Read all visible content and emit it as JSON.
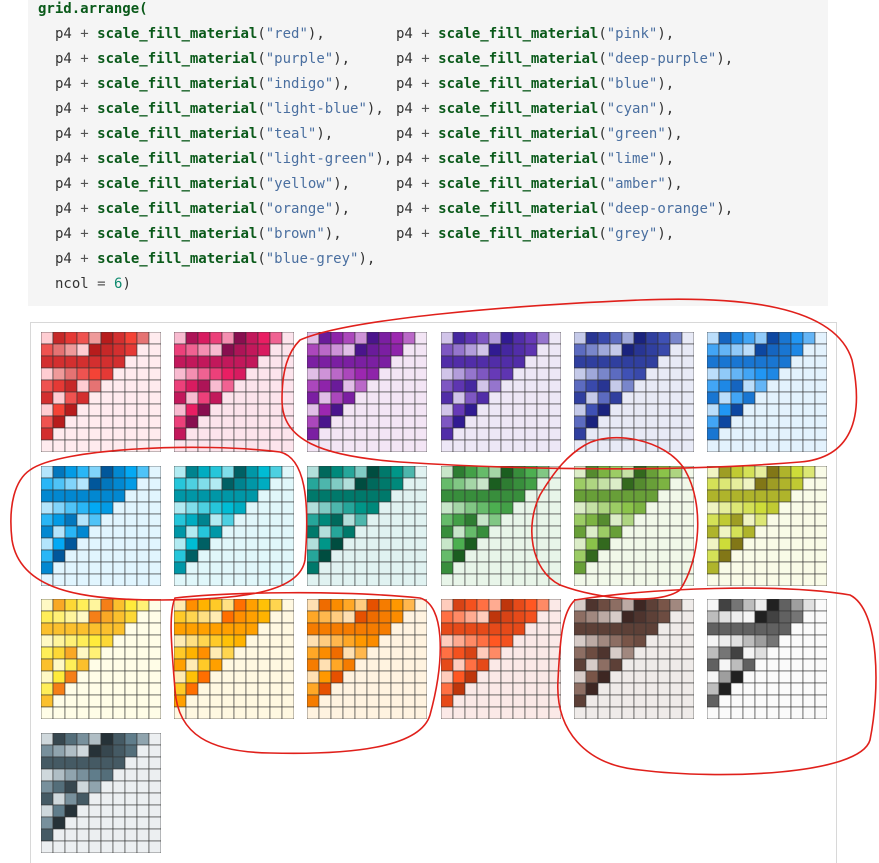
{
  "code": {
    "open": "grid.arrange(",
    "plot_var": "p4",
    "plus": "+",
    "function": "scale_fill_material",
    "palettes": [
      "red",
      "pink",
      "purple",
      "deep-purple",
      "indigo",
      "blue",
      "light-blue",
      "cyan",
      "teal",
      "green",
      "light-green",
      "lime",
      "yellow",
      "amber",
      "orange",
      "deep-orange",
      "brown",
      "grey",
      "blue-grey"
    ],
    "ncol_label": "ncol",
    "ncol_equals": "=",
    "ncol_value": "6",
    "close": ")"
  },
  "chart_data": {
    "type": "heatmap",
    "layout": {
      "ncol": 6,
      "count": 19
    },
    "plots": [
      {
        "palette": "red",
        "colors": [
          "#ffebee",
          "#ffcdd2",
          "#ef9a9a",
          "#e57373",
          "#ef5350",
          "#f44336",
          "#e53935",
          "#d32f2f",
          "#c62828",
          "#b71c1c"
        ]
      },
      {
        "palette": "pink",
        "colors": [
          "#fce4ec",
          "#f8bbd0",
          "#f48fb1",
          "#f06292",
          "#ec407a",
          "#e91e63",
          "#d81b60",
          "#c2185b",
          "#ad1457",
          "#880e4f"
        ]
      },
      {
        "palette": "purple",
        "colors": [
          "#f3e5f5",
          "#e1bee7",
          "#ce93d8",
          "#ba68c8",
          "#ab47bc",
          "#9c27b0",
          "#8e24aa",
          "#7b1fa2",
          "#6a1b9a",
          "#4a148c"
        ]
      },
      {
        "palette": "deep-purple",
        "colors": [
          "#ede7f6",
          "#d1c4e9",
          "#b39ddb",
          "#9575cd",
          "#7e57c2",
          "#673ab7",
          "#5e35b1",
          "#512da8",
          "#4527a0",
          "#311b92"
        ]
      },
      {
        "palette": "indigo",
        "colors": [
          "#e8eaf6",
          "#c5cae9",
          "#9fa8da",
          "#7986cb",
          "#5c6bc0",
          "#3f51b5",
          "#3949ab",
          "#303f9f",
          "#283593",
          "#1a237e"
        ]
      },
      {
        "palette": "blue",
        "colors": [
          "#e3f2fd",
          "#bbdefb",
          "#90caf9",
          "#64b5f6",
          "#42a5f5",
          "#2196f3",
          "#1e88e5",
          "#1976d2",
          "#1565c0",
          "#0d47a1"
        ]
      },
      {
        "palette": "light-blue",
        "colors": [
          "#e1f5fe",
          "#b3e5fc",
          "#81d4fa",
          "#4fc3f7",
          "#29b6f6",
          "#03a9f4",
          "#039be5",
          "#0288d1",
          "#0277bd",
          "#01579b"
        ]
      },
      {
        "palette": "cyan",
        "colors": [
          "#e0f7fa",
          "#b2ebf2",
          "#80deea",
          "#4dd0e1",
          "#26c6da",
          "#00bcd4",
          "#00acc1",
          "#0097a7",
          "#00838f",
          "#006064"
        ]
      },
      {
        "palette": "teal",
        "colors": [
          "#e0f2f1",
          "#b2dfdb",
          "#80cbc4",
          "#4db6ac",
          "#26a69a",
          "#009688",
          "#00897b",
          "#00796b",
          "#00695c",
          "#004d40"
        ]
      },
      {
        "palette": "green",
        "colors": [
          "#e8f5e9",
          "#c8e6c9",
          "#a5d6a7",
          "#81c784",
          "#66bb6a",
          "#4caf50",
          "#43a047",
          "#388e3c",
          "#2e7d32",
          "#1b5e20"
        ]
      },
      {
        "palette": "light-green",
        "colors": [
          "#f1f8e9",
          "#dcedc8",
          "#c5e1a5",
          "#aed581",
          "#9ccc65",
          "#8bc34a",
          "#7cb342",
          "#689f38",
          "#558b2f",
          "#33691e"
        ]
      },
      {
        "palette": "lime",
        "colors": [
          "#f9fbe7",
          "#f0f4c3",
          "#e6ee9c",
          "#dce775",
          "#d4e157",
          "#cddc39",
          "#c0ca33",
          "#afb42b",
          "#9e9d24",
          "#827717"
        ]
      },
      {
        "palette": "yellow",
        "colors": [
          "#fffde7",
          "#fff9c4",
          "#fff59d",
          "#fff176",
          "#ffee58",
          "#ffeb3b",
          "#fdd835",
          "#fbc02d",
          "#f9a825",
          "#f57f17"
        ]
      },
      {
        "palette": "amber",
        "colors": [
          "#fff8e1",
          "#ffecb3",
          "#ffe082",
          "#ffd54f",
          "#ffca28",
          "#ffc107",
          "#ffb300",
          "#ffa000",
          "#ff8f00",
          "#ff6f00"
        ]
      },
      {
        "palette": "orange",
        "colors": [
          "#fff3e0",
          "#ffe0b2",
          "#ffcc80",
          "#ffb74d",
          "#ffa726",
          "#ff9800",
          "#fb8c00",
          "#f57c00",
          "#ef6c00",
          "#e65100"
        ]
      },
      {
        "palette": "deep-orange",
        "colors": [
          "#fbe9e7",
          "#ffccbc",
          "#ffab91",
          "#ff8a65",
          "#ff7043",
          "#ff5722",
          "#f4511e",
          "#e64a19",
          "#d84315",
          "#bf360c"
        ]
      },
      {
        "palette": "brown",
        "colors": [
          "#efebe9",
          "#d7ccc8",
          "#bcaaa4",
          "#a1887f",
          "#8d6e63",
          "#795548",
          "#6d4c41",
          "#5d4037",
          "#4e342e",
          "#3e2723"
        ]
      },
      {
        "palette": "grey",
        "colors": [
          "#fafafa",
          "#f5f5f5",
          "#eeeeee",
          "#e0e0e0",
          "#bdbdbd",
          "#9e9e9e",
          "#757575",
          "#616161",
          "#424242",
          "#212121"
        ]
      },
      {
        "palette": "blue-grey",
        "colors": [
          "#eceff1",
          "#cfd8dc",
          "#b0bec5",
          "#90a4ae",
          "#78909c",
          "#607d8b",
          "#546e7a",
          "#455a64",
          "#37474f",
          "#263238"
        ]
      }
    ]
  },
  "annotations": {
    "color": "#e0201b"
  }
}
